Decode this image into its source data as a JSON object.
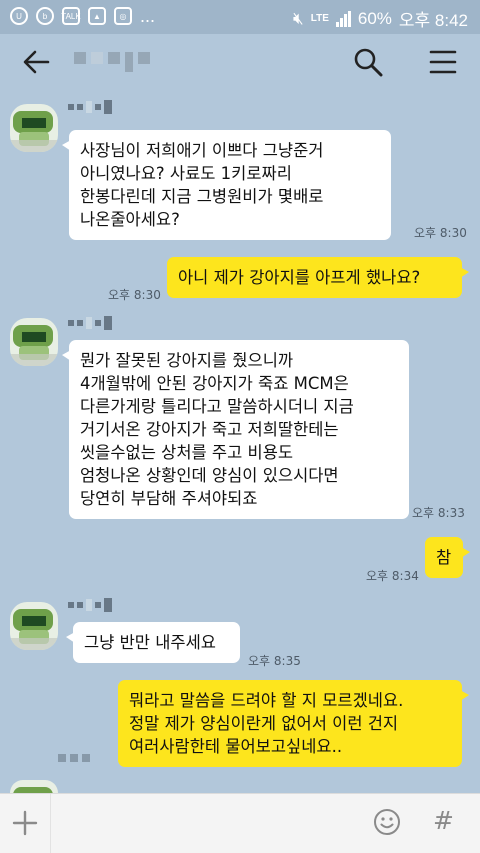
{
  "status_bar": {
    "network": "LTE",
    "battery": "60%",
    "time": "오후 8:42",
    "notification_icons": [
      "app-icon",
      "app-icon",
      "talk-icon",
      "image-icon",
      "instagram-icon"
    ],
    "more": "..."
  },
  "header": {
    "back_icon": "arrow-left-icon",
    "search_icon": "search-icon",
    "menu_icon": "hamburger-menu-icon"
  },
  "messages": [
    {
      "direction": "incoming",
      "text": "사장님이 저희애기 이쁘다 그냥준거\n아니였나요? 사료도 1키로짜리\n한봉다린데 지금 그병원비가 몇배로\n나온줄아세요?",
      "time": "오후 8:30"
    },
    {
      "direction": "outgoing",
      "text": "아니 제가 강아지를 아프게 했나요?",
      "time": "오후 8:30"
    },
    {
      "direction": "incoming",
      "text": "뭔가 잘못된 강아지를 줬으니까\n4개월밖에 안된 강아지가 죽죠 MCM은\n다른가게랑 틀리다고 말씀하시더니 지금\n거기서온 강아지가 죽고 저희딸한테는\n씻을수없는 상처를 주고 비용도\n엄청나온 상황인데 양심이 있으시다면\n당연히 부담해 주셔야되죠",
      "time": "오후 8:33"
    },
    {
      "direction": "outgoing",
      "text": "참",
      "time": "오후 8:34"
    },
    {
      "direction": "incoming",
      "text": "그냥 반만 내주세요",
      "time": "오후 8:35"
    },
    {
      "direction": "outgoing",
      "text": "뭐라고 말씀을 드려야 할 지 모르겠네요.\n정말 제가 양심이란게 없어서 이런 건지\n여러사람한테 물어보고싶네요..",
      "time": ""
    }
  ],
  "input_bar": {
    "plus_icon": "plus-icon",
    "emoji_icon": "emoji-icon",
    "hash_label": "#"
  },
  "colors": {
    "chat_background": "#b2c7da",
    "outgoing_bubble": "#fde51d",
    "incoming_bubble": "#ffffff"
  }
}
